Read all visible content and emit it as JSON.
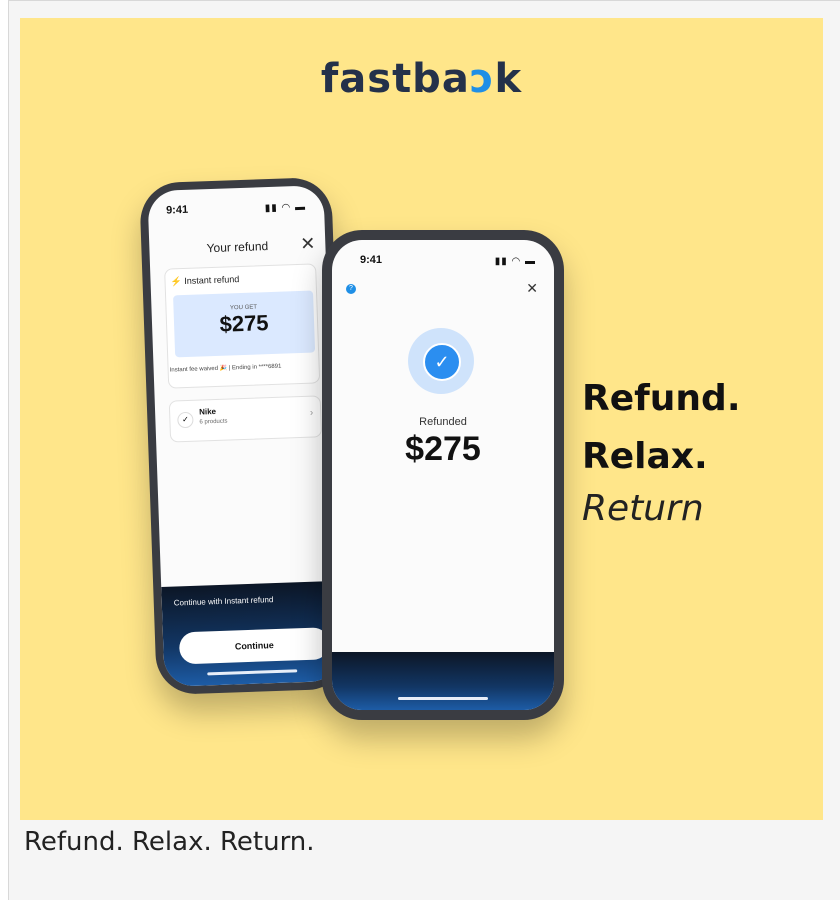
{
  "logo": {
    "pre": "fastba",
    "mark": "ↄ",
    "post": "k"
  },
  "tagline": {
    "line1": "Refund.",
    "line2": "Relax.",
    "line3": "Return"
  },
  "caption": "Refund. Relax. Return.",
  "back_phone": {
    "time": "9:41",
    "title": "Your refund",
    "instant_label": "Instant refund",
    "you_get": "YOU GET",
    "amount": "$275",
    "fee_line": "Instant fee waived 🎉 | Ending in ****6891",
    "store_name": "Nike",
    "store_sub": "6 products",
    "continue_prompt": "Continue with Instant refund",
    "continue_label": "Continue"
  },
  "front_phone": {
    "time": "9:41",
    "status_label": "Refunded",
    "amount": "$275"
  },
  "colors": {
    "background": "#ffe68a",
    "brand": "#24314a",
    "accent": "#1f8fe6"
  }
}
